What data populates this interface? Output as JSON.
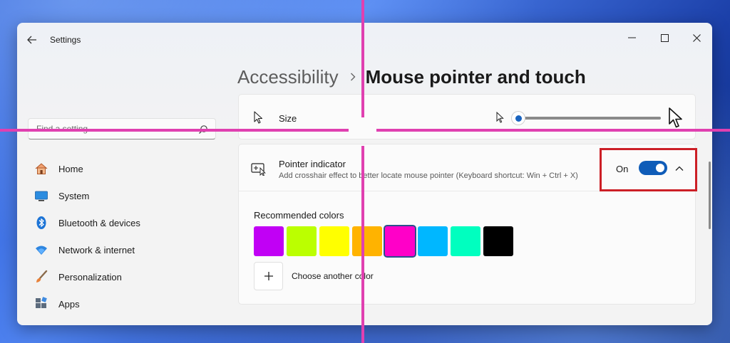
{
  "window": {
    "app_title": "Settings",
    "controls": [
      "minimize-icon",
      "maximize-icon",
      "close-icon"
    ]
  },
  "breadcrumb": {
    "parent": "Accessibility",
    "separator_icon": "chevron-right-icon",
    "current": "Mouse pointer and touch"
  },
  "search": {
    "placeholder": "Find a setting",
    "icon": "search-icon"
  },
  "sidebar": {
    "items": [
      {
        "label": "Home",
        "icon": "home-icon"
      },
      {
        "label": "System",
        "icon": "system-icon"
      },
      {
        "label": "Bluetooth & devices",
        "icon": "bluetooth-icon"
      },
      {
        "label": "Network & internet",
        "icon": "wifi-icon"
      },
      {
        "label": "Personalization",
        "icon": "brush-icon"
      },
      {
        "label": "Apps",
        "icon": "apps-icon"
      }
    ]
  },
  "size_setting": {
    "label": "Size",
    "icon": "mouse-pointer-icon",
    "slider_value_fraction": 0.0
  },
  "pointer_indicator": {
    "title": "Pointer indicator",
    "description": "Add crosshair effect to better locate mouse pointer (Keyboard shortcut: Win + Ctrl + X)",
    "icon": "pointer-indicator-icon",
    "toggle_label": "On",
    "toggle_state": true,
    "expanded": true
  },
  "recommended_colors": {
    "label": "Recommended colors",
    "swatches": [
      {
        "color": "#c100f5",
        "selected": false
      },
      {
        "color": "#bbff00",
        "selected": false
      },
      {
        "color": "#ffff00",
        "selected": false
      },
      {
        "color": "#ffb300",
        "selected": false
      },
      {
        "color": "#ff00c8",
        "selected": true
      },
      {
        "color": "#00b7ff",
        "selected": false
      },
      {
        "color": "#00ffbf",
        "selected": false
      },
      {
        "color": "#000000",
        "selected": false
      }
    ],
    "add_label": "Choose another color"
  },
  "colors": {
    "accent": "#0f5cb8",
    "crosshair": "#e040b0",
    "highlight_box": "#cc1f26"
  }
}
